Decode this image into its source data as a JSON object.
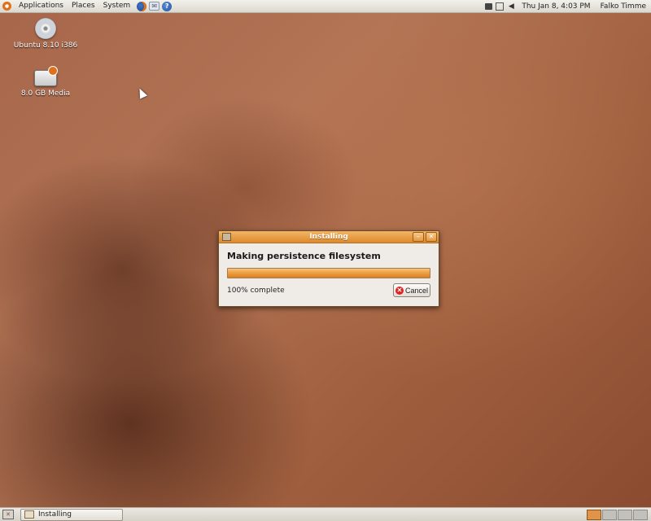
{
  "top_panel": {
    "menus": [
      "Applications",
      "Places",
      "System"
    ],
    "clock": "Thu Jan  8,  4:03 PM",
    "user": "Falko Timme"
  },
  "desktop": {
    "icons": [
      {
        "label": "Ubuntu 8.10 i386",
        "icon": "cd-icon"
      },
      {
        "label": "8.0 GB Media",
        "icon": "usb-drive-icon"
      }
    ]
  },
  "dialog": {
    "title": "Installing",
    "heading": "Making persistence filesystem",
    "progress_fraction": 1.0,
    "progress_text": "100% complete",
    "cancel_label": "Cancel",
    "minimize_symbol": "–",
    "close_symbol": "✕"
  },
  "bottom_panel": {
    "task_label": "Installing",
    "workspaces": 4,
    "active_workspace": 1
  },
  "colors": {
    "accent": "#dd8a2b",
    "progress": "#eb9a3c"
  }
}
